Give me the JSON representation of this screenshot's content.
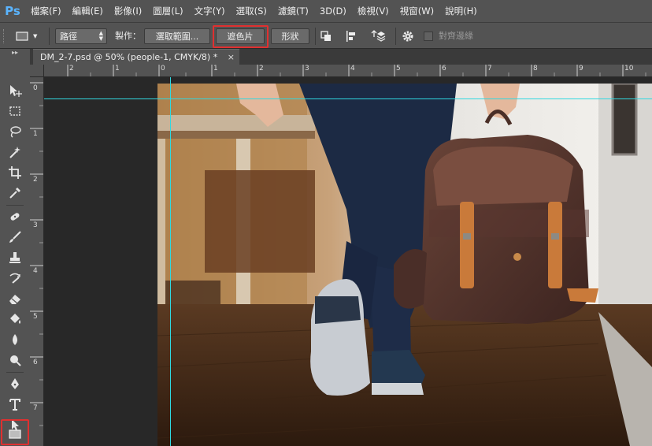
{
  "app": {
    "logo": "Ps"
  },
  "menu": [
    "檔案(F)",
    "編輯(E)",
    "影像(I)",
    "圖層(L)",
    "文字(Y)",
    "選取(S)",
    "濾鏡(T)",
    "3D(D)",
    "檢視(V)",
    "視窗(W)",
    "說明(H)"
  ],
  "options": {
    "tool_mode": "路徑",
    "make_label": "製作：",
    "selection_button": "選取範圍...",
    "mask_button": "遮色片",
    "shape_button": "形狀",
    "align_edges_label": "對齊邊緣"
  },
  "document": {
    "tab_title": "DM_2-7.psd @ 50% (people-1, CMYK/8) *",
    "close_glyph": "×"
  },
  "rulers": {
    "horizontal": [
      "2",
      "1",
      "0",
      "1",
      "2",
      "3",
      "4",
      "5",
      "6",
      "7",
      "8",
      "9",
      "10"
    ],
    "vertical": [
      "0",
      "1",
      "2",
      "3",
      "4",
      "5",
      "6",
      "7"
    ]
  },
  "tools": [
    "move-tool",
    "marquee-tool",
    "lasso-tool",
    "magic-wand-tool",
    "crop-tool",
    "eyedropper-tool",
    "healing-brush-tool",
    "brush-tool",
    "clone-stamp-tool",
    "history-brush-tool",
    "eraser-tool",
    "paint-bucket-tool",
    "blur-tool",
    "dodge-tool",
    "pen-tool",
    "type-tool",
    "path-selection-tool",
    "rectangle-tool"
  ],
  "colors": {
    "highlight": "#e03030",
    "guide": "#30d8e0",
    "ps_blue": "#5ab4ff"
  }
}
